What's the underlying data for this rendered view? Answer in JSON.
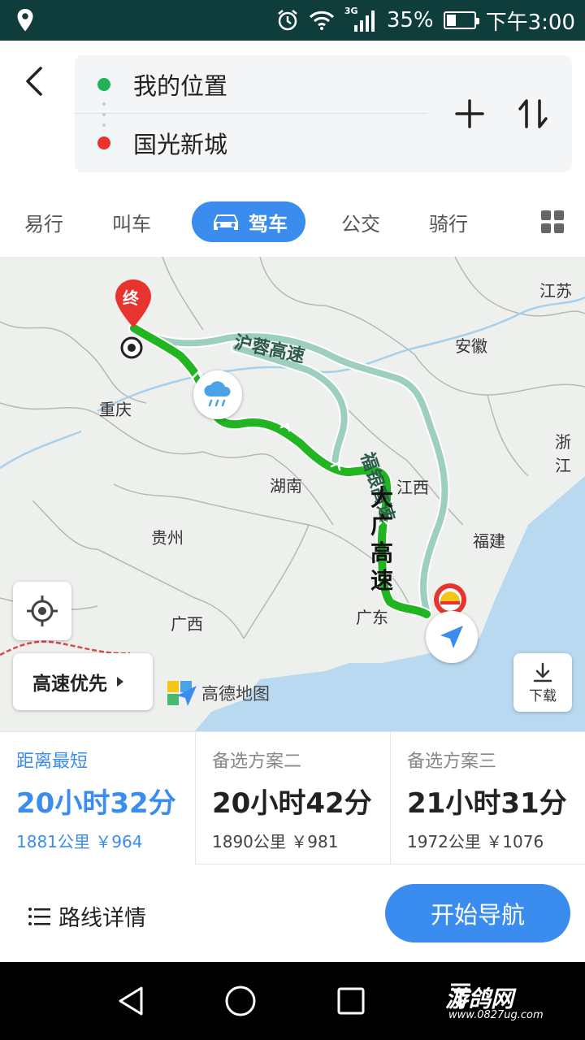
{
  "statusbar": {
    "network": "3G",
    "battery": "35%",
    "battery_level": 0.35,
    "time": "下午3:00",
    "icons": [
      "location-icon",
      "alarm-icon",
      "wifi-icon",
      "signal-icon",
      "battery-icon"
    ]
  },
  "route": {
    "origin": "我的位置",
    "destination": "国光新城",
    "origin_color": "#22b35a",
    "destination_color": "#e8342f"
  },
  "tabs": [
    {
      "label": "易行"
    },
    {
      "label": "叫车"
    },
    {
      "label": "驾车",
      "active": true
    },
    {
      "label": "公交"
    },
    {
      "label": "骑行"
    }
  ],
  "map": {
    "provinces": [
      "江苏",
      "安徽",
      "重庆",
      "浙江",
      "湖南",
      "江西",
      "贵州",
      "福建",
      "广西",
      "广东"
    ],
    "roads": [
      "沪蓉高速",
      "福银高速",
      "大广高速"
    ],
    "end_marker": "终",
    "preference": "高速优先",
    "download": "下载",
    "logo": "高德地图",
    "route_color": "#21b521",
    "alt_route_color": "#9ccfc0"
  },
  "options": [
    {
      "name": "距离最短",
      "time": "20小时32分",
      "distance": "1881公里",
      "toll": "￥964",
      "selected": true
    },
    {
      "name": "备选方案二",
      "time": "20小时42分",
      "distance": "1890公里",
      "toll": "￥981"
    },
    {
      "name": "备选方案三",
      "time": "21小时31分",
      "distance": "1972公里",
      "toll": "￥1076"
    }
  ],
  "actions": {
    "detail": "路线详情",
    "start": "开始导航"
  },
  "watermark": {
    "brand": "游鸽网",
    "url": "www.0827ug.com"
  },
  "accent": "#3a8dee"
}
